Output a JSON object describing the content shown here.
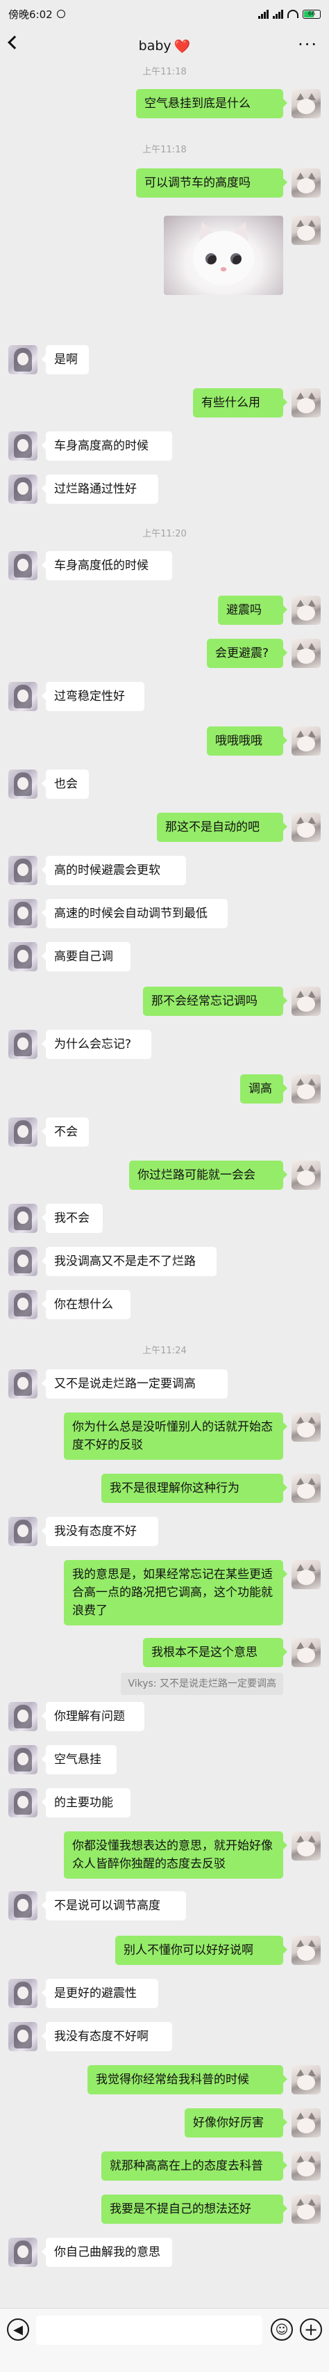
{
  "status_bar": {
    "carrier_time": "傍晚6:02",
    "battery": "66"
  },
  "header": {
    "title": "baby",
    "title_emoji": "❤️",
    "more": "···"
  },
  "timestamps": [
    "上午11:18",
    "上午11:18",
    "上午11:20",
    "上午11:24"
  ],
  "image_message": {
    "alt": "white kitten photo"
  },
  "messages": [
    "空气悬挂到底是什么",
    "可以调节车的高度吗",
    "是啊",
    "有些什么用",
    "车身高度高的时候",
    "过烂路通过性好",
    "车身高度低的时候",
    "避震吗",
    "会更避震?",
    "过弯稳定性好",
    "哦哦哦哦",
    "也会",
    "那这不是自动的吧",
    "高的时候避震会更软",
    "高速的时候会自动调节到最低",
    "高要自己调",
    "那不会经常忘记调吗",
    "为什么会忘记?",
    "调高",
    "不会",
    "你过烂路可能就一会会",
    "我不会",
    "我没调高又不是走不了烂路",
    "你在想什么",
    "又不是说走烂路一定要调高",
    "你为什么总是没听懂别人的话就开始态度不好的反驳",
    "我不是很理解你这种行为",
    "我没有态度不好",
    "我的意思是，如果经常忘记在某些更适合高一点的路况把它调高，这个功能就浪费了",
    "我根本不是这个意思",
    "你理解有问题",
    "空气悬挂",
    "的主要功能",
    "你都没懂我想表达的意思，就开始好像众人皆醉你独醒的态度去反驳",
    "不是说可以调节高度",
    "别人不懂你可以好好说啊",
    "是更好的避震性",
    "我没有态度不好啊",
    "我觉得你经常给我科普的时候",
    "好像你好厉害",
    "就那种高高在上的态度去科普",
    "我要是不提自己的想法还好",
    "你自己曲解我的意思"
  ],
  "quote": {
    "author": "Vikys",
    "text": "Vikys: 又不是说走烂路一定要调高"
  },
  "input_bar": {
    "placeholder": ""
  }
}
